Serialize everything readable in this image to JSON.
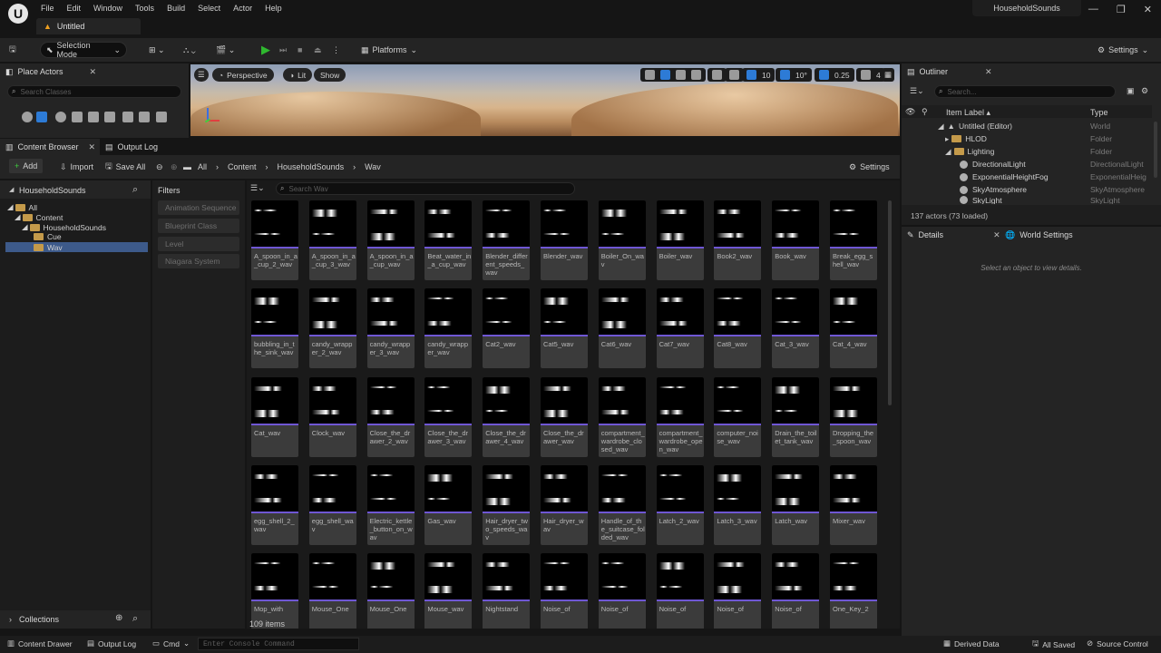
{
  "menu": [
    "File",
    "Edit",
    "Window",
    "Tools",
    "Build",
    "Select",
    "Actor",
    "Help"
  ],
  "document_tab": "Untitled",
  "project_name": "HouseholdSounds",
  "toolbar": {
    "mode": "Selection Mode",
    "platforms": "Platforms",
    "settings": "Settings"
  },
  "place_actors": {
    "tab": "Place Actors",
    "search_placeholder": "Search Classes"
  },
  "viewport": {
    "perspective": "Perspective",
    "lit": "Lit",
    "show": "Show",
    "grid_snap": "10",
    "rot_snap": "10°",
    "scale_snap": "0.25",
    "camera_speed": "4"
  },
  "outliner": {
    "tab": "Outliner",
    "search_placeholder": "Search...",
    "col_label": "Item Label ▴",
    "col_type": "Type",
    "rows": [
      {
        "label": "Untitled (Editor)",
        "type": "World"
      },
      {
        "label": "HLOD",
        "type": "Folder"
      },
      {
        "label": "Lighting",
        "type": "Folder"
      },
      {
        "label": "DirectionalLight",
        "type": "DirectionalLight"
      },
      {
        "label": "ExponentialHeightFog",
        "type": "ExponentialHeig"
      },
      {
        "label": "SkyAtmosphere",
        "type": "SkyAtmosphere"
      },
      {
        "label": "SkyLight",
        "type": "SkyLight"
      }
    ],
    "status": "137 actors (73 loaded)"
  },
  "details": {
    "tab": "Details",
    "world_settings": "World Settings",
    "empty_msg": "Select an object to view details."
  },
  "content_browser": {
    "tab": "Content Browser",
    "output_tab": "Output Log",
    "add": "Add",
    "import": "Import",
    "save_all": "Save All",
    "breadcrumb": [
      "All",
      "Content",
      "HouseholdSounds",
      "Wav"
    ],
    "settings": "Settings",
    "source_title": "HouseholdSounds",
    "tree": [
      "All",
      "Content",
      "HouseholdSounds",
      "Cue",
      "Wav"
    ],
    "filters_title": "Filters",
    "filters": [
      "Animation Sequence",
      "Blueprint Class",
      "Level",
      "Niagara System"
    ],
    "search_placeholder": "Search Wav",
    "item_count": "109 items",
    "collections": "Collections",
    "assets": [
      "A_spoon_in_a_cup_2_wav",
      "A_spoon_in_a_cup_3_wav",
      "A_spoon_in_a_cup_wav",
      "Beat_water_in_a_cup_wav",
      "Blender_different_speeds_wav",
      "Blender_wav",
      "Boiler_On_wav",
      "Boiler_wav",
      "Book2_wav",
      "Book_wav",
      "Break_egg_shell_wav",
      "bubbling_in_the_sink_wav",
      "candy_wrapper_2_wav",
      "candy_wrapper_3_wav",
      "candy_wrapper_wav",
      "Cat2_wav",
      "Cat5_wav",
      "Cat6_wav",
      "Cat7_wav",
      "Cat8_wav",
      "Cat_3_wav",
      "Cat_4_wav",
      "Cat_wav",
      "Clock_wav",
      "Close_the_drawer_2_wav",
      "Close_the_drawer_3_wav",
      "Close_the_drawer_4_wav",
      "Close_the_drawer_wav",
      "compartment_wardrobe_closed_wav",
      "compartment_wardrobe_open_wav",
      "computer_noise_wav",
      "Drain_the_toilet_tank_wav",
      "Dropping_the_spoon_wav",
      "egg_shell_2_wav",
      "egg_shell_wav",
      "Electric_kettle_button_on_wav",
      "Gas_wav",
      "Hair_dryer_two_speeds_wav",
      "Hair_dryer_wav",
      "Handle_of_the_suitcase_folded_wav",
      "Latch_2_wav",
      "Latch_3_wav",
      "Latch_wav",
      "Mixer_wav",
      "Mop_with",
      "Mouse_One",
      "Mouse_One",
      "Mouse_wav",
      "Nightstand",
      "Noise_of",
      "Noise_of",
      "Noise_of",
      "Noise_of",
      "Noise_of",
      "One_Key_2"
    ]
  },
  "statusbar": {
    "content_drawer": "Content Drawer",
    "output_log": "Output Log",
    "cmd": "Cmd",
    "console_placeholder": "Enter Console Command",
    "derived_data": "Derived Data",
    "all_saved": "All Saved",
    "source_control": "Source Control"
  }
}
